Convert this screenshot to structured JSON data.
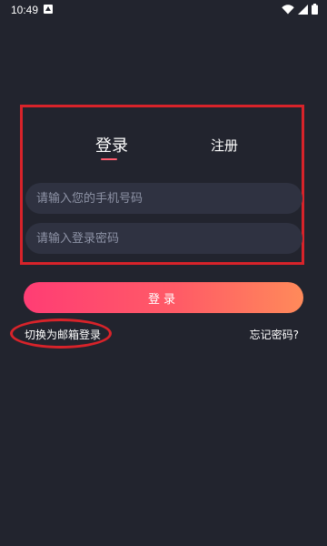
{
  "status_bar": {
    "time": "10:49",
    "icons": [
      "app-notification-icon",
      "wifi-icon",
      "signal-icon",
      "battery-icon"
    ]
  },
  "tabs": {
    "login_label": "登录",
    "register_label": "注册"
  },
  "form": {
    "phone_placeholder": "请输入您的手机号码",
    "password_placeholder": "请输入登录密码",
    "submit_label": "登录"
  },
  "links": {
    "switch_email": "切换为邮箱登录",
    "forgot_password": "忘记密码?"
  },
  "colors": {
    "background": "#22242e",
    "input_bg": "#2f3241",
    "accent_start": "#ff3d74",
    "accent_end": "#ff8a5a",
    "annotation_red": "#d8232a"
  }
}
